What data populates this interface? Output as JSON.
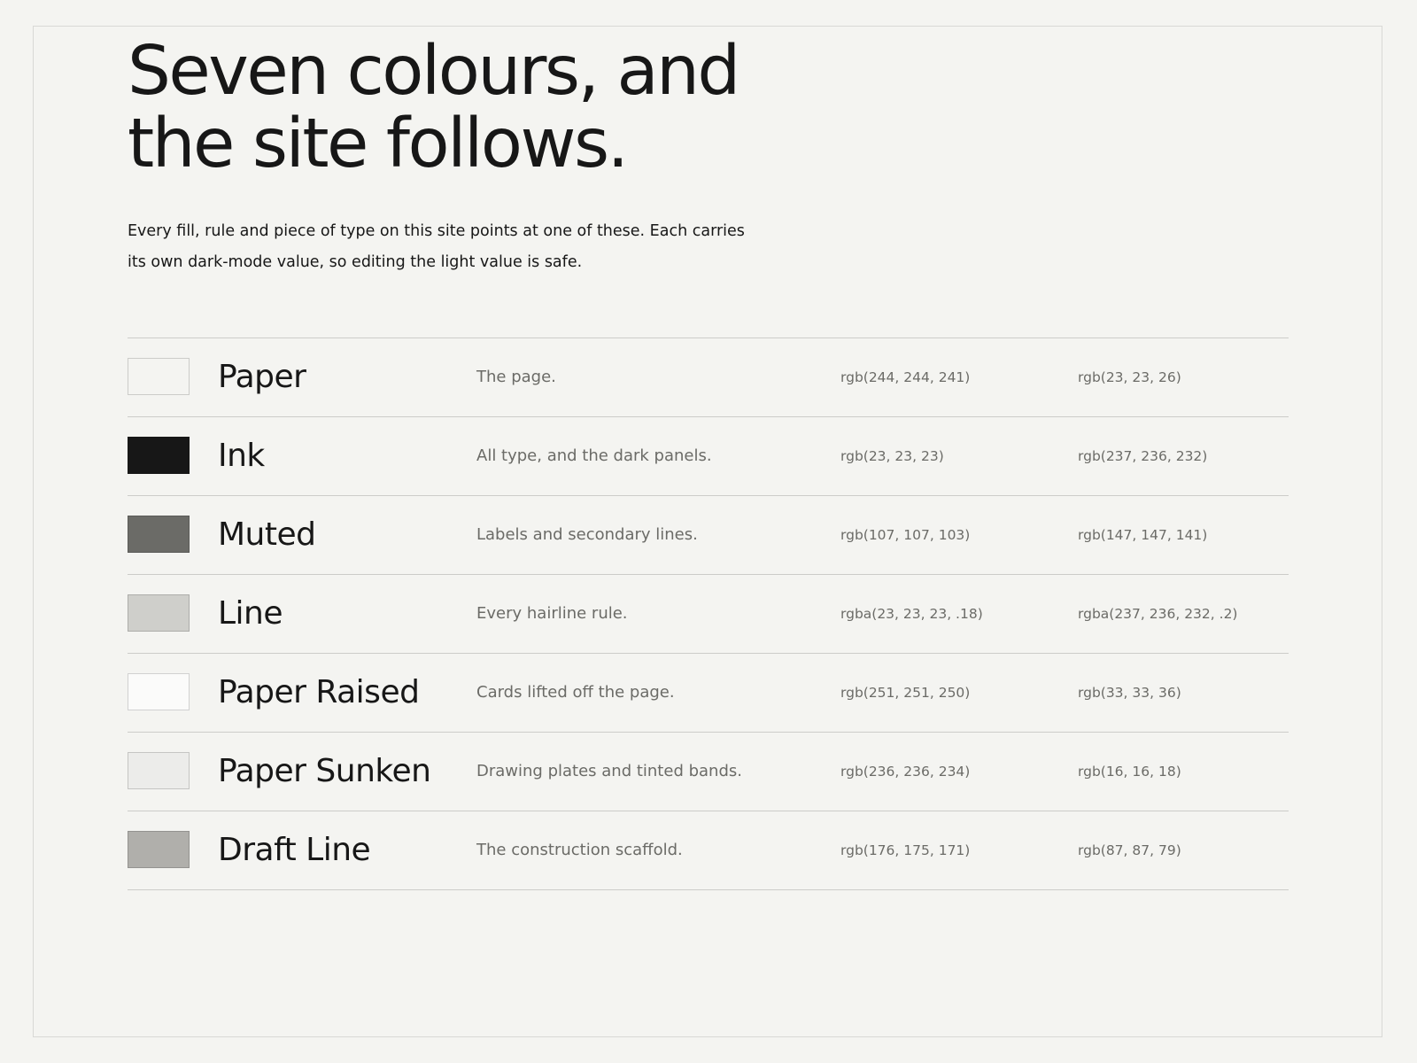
{
  "header": {
    "headline_line1": "Seven colours, and",
    "headline_line2": "the site follows.",
    "intro_line1": "Every fill, rule and piece of type on this site points at one of these. Each carries",
    "intro_line2": "its own dark-mode value, so editing the light value is safe."
  },
  "tokens": [
    {
      "name": "Paper",
      "description": "The page.",
      "light": "rgb(244, 244, 241)",
      "dark": "rgb(23, 23, 26)",
      "swatch_color": "#f4f4f1"
    },
    {
      "name": "Ink",
      "description": "All type, and the dark panels.",
      "light": "rgb(23, 23, 23)",
      "dark": "rgb(237, 236, 232)",
      "swatch_color": "#171717"
    },
    {
      "name": "Muted",
      "description": "Labels and secondary lines.",
      "light": "rgb(107, 107, 103)",
      "dark": "rgb(147, 147, 141)",
      "swatch_color": "#6b6b67"
    },
    {
      "name": "Line",
      "description": "Every hairline rule.",
      "light": "rgba(23, 23, 23, .18)",
      "dark": "rgba(237, 236, 232, .2)",
      "swatch_color": "#cfcfcb"
    },
    {
      "name": "Paper Raised",
      "description": "Cards lifted off the page.",
      "light": "rgb(251, 251, 250)",
      "dark": "rgb(33, 33, 36)",
      "swatch_color": "#fbfbfa"
    },
    {
      "name": "Paper Sunken",
      "description": "Drawing plates and tinted bands.",
      "light": "rgb(236, 236, 234)",
      "dark": "rgb(16, 16, 18)",
      "swatch_color": "#ececea"
    },
    {
      "name": "Draft Line",
      "description": "The construction scaffold.",
      "light": "rgb(176, 175, 171)",
      "dark": "rgb(87, 87, 79)",
      "swatch_color": "#b0afab"
    }
  ]
}
